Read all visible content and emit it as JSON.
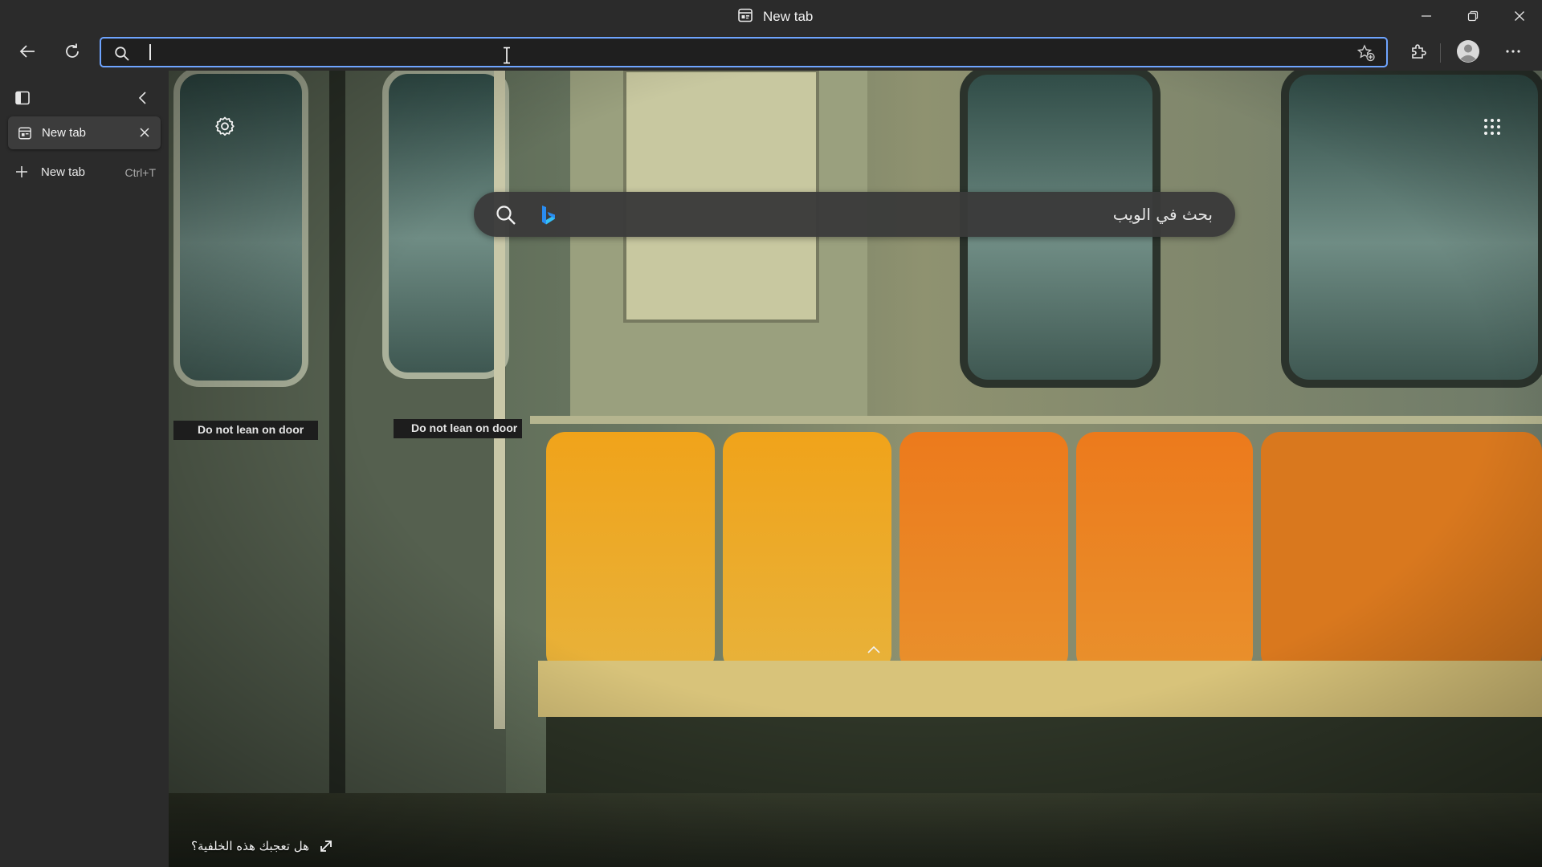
{
  "window": {
    "title": "New tab",
    "controls": [
      "minimize",
      "maximize",
      "close"
    ]
  },
  "toolbar": {
    "back_icon": "back-arrow-icon",
    "refresh_icon": "refresh-icon",
    "address": {
      "value": "",
      "placeholder": ""
    },
    "favorite_icon": "add-favorite-icon",
    "extensions_icon": "extensions-icon",
    "profile_icon": "profile-avatar-icon",
    "menu_icon": "more-icon"
  },
  "sidebar": {
    "tabs": [
      {
        "label": "New tab",
        "active": true
      }
    ],
    "new_tab": {
      "label": "New tab",
      "shortcut": "Ctrl+T"
    }
  },
  "ntp": {
    "search_placeholder": "بحث في الويب",
    "like_background_text": "هل تعجبك هذه الخلفية؟",
    "background_signs": [
      "Do not lean on door",
      "Do not lean on door"
    ]
  },
  "colors": {
    "chrome_bg": "#2b2b2b",
    "address_focus_border": "#6ea4ff",
    "tab_active_bg": "#3c3c3c",
    "search_box_bg": "#3a3a3a"
  }
}
